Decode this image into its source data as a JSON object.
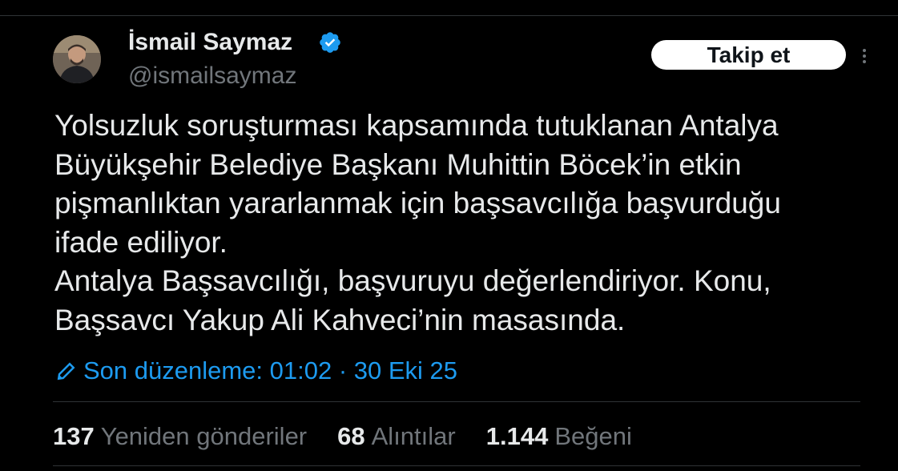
{
  "author": {
    "display_name": "İsmail Saymaz",
    "handle": "@ismailsaymaz",
    "verified_icon": "verified-badge-icon",
    "avatar_icon": "avatar"
  },
  "follow_button": {
    "label": "Takip et"
  },
  "more_icon": "more-options-icon",
  "tweet": {
    "lines": [
      "Yolsuzluk soruşturması kapsamında tutuklanan Antalya",
      "Büyükşehir Belediye Başkanı Muhittin Böcek’in etkin",
      "pişmanlıktan yararlanmak için başsavcılığa başvurduğu",
      "ifade ediliyor.",
      "Antalya Başsavcılığı, başvuruyu değerlendiriyor. Konu,",
      "Başsavcı Yakup Ali Kahveci’nin masasında."
    ]
  },
  "edit_info": {
    "icon": "pencil-icon",
    "label": "Son düzenleme: 01:02 · 30 Eki 25"
  },
  "stats": [
    {
      "count": "137",
      "label": "Yeniden gönderiler"
    },
    {
      "count": "68",
      "label": "Alıntılar"
    },
    {
      "count": "1.144",
      "label": "Beğeni"
    }
  ],
  "colors": {
    "background": "#000000",
    "text": "#e7e9ea",
    "secondary": "#71767b",
    "accent": "#1d9bf0",
    "divider": "#2f3336"
  }
}
